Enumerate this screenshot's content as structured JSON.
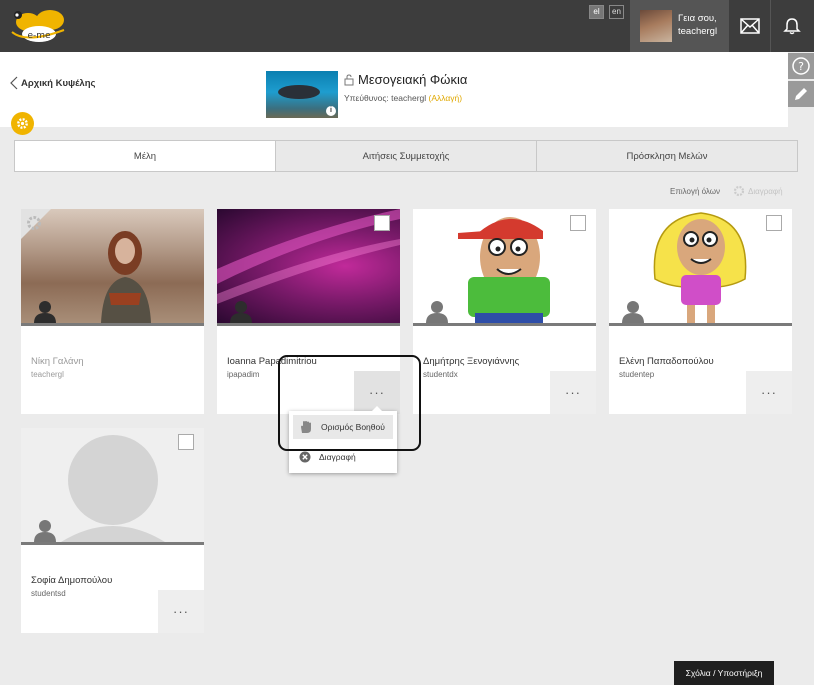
{
  "topbar": {
    "logo_text": "e-me",
    "lang_el": "el",
    "lang_en": "en",
    "greeting_line1": "Γεια σου,",
    "greeting_line2": "teachergl",
    "icons": [
      "mail-icon",
      "bell-icon"
    ]
  },
  "side_tools": {
    "help": "?",
    "icons": [
      "help-icon",
      "pencil-icon"
    ]
  },
  "header": {
    "back_label": "Αρχική Κυψέλης",
    "hive_title": "Μεσογειακή Φώκια",
    "owner_label": "Υπεύθυνος:",
    "owner_name": "teachergl",
    "change_link": "(Αλλαγή)",
    "info": "i"
  },
  "tabs": [
    {
      "label": "Μέλη",
      "active": true
    },
    {
      "label": "Αιτήσεις Συμμετοχής",
      "active": false
    },
    {
      "label": "Πρόσκληση Μελών",
      "active": false
    }
  ],
  "toolbar": {
    "select_all": "Επιλογή όλων",
    "delete_selected": "Διαγραφή"
  },
  "members": [
    {
      "name": "Νίκη Γαλάνη",
      "username": "teachergl",
      "role": "owner"
    },
    {
      "name": "Ioanna Papadimitriou",
      "username": "ipapadim",
      "role": "member"
    },
    {
      "name": "Δημήτρης Ξενογιάννης",
      "username": "studentdx",
      "role": "member"
    },
    {
      "name": "Ελένη Παπαδοπούλου",
      "username": "studentep",
      "role": "member"
    },
    {
      "name": "Σοφία Δημοπούλου",
      "username": "studentsd",
      "role": "member"
    }
  ],
  "more_label": "···",
  "dropdown": {
    "assign_helper": "Ορισμός Βοηθού",
    "delete": "Διαγραφή"
  },
  "feedback_button": "Σχόλια / Υποστήριξη",
  "colors": {
    "topbar": "#3d3d3d",
    "accent": "#f0b400",
    "card_line": "#7a7a7a"
  }
}
